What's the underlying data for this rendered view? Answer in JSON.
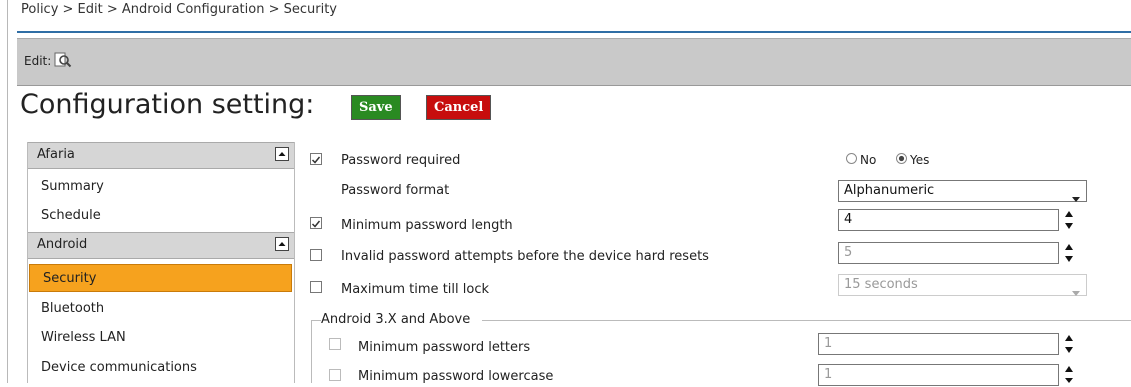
{
  "breadcrumb": "Policy > Edit > Android Configuration > Security",
  "editbar": {
    "label": "Edit:",
    "icon": "search-document-icon"
  },
  "heading": "Configuration setting:",
  "buttons": {
    "save": "Save",
    "cancel": "Cancel"
  },
  "colors": {
    "accent": "#2f6ea5",
    "save": "#2a8a22",
    "cancel": "#c70d0d",
    "active_item": "#f6a21e"
  },
  "sidebar": {
    "sections": [
      {
        "label": "Afaria",
        "items": [
          "Summary",
          "Schedule"
        ]
      },
      {
        "label": "Android",
        "items": [
          "Security",
          "Bluetooth",
          "Wireless LAN",
          "Device communications"
        ]
      }
    ],
    "active": "Security"
  },
  "settings": {
    "password_required": {
      "label": "Password required",
      "checked": true,
      "no": "No",
      "yes": "Yes",
      "selected": "Yes"
    },
    "password_format": {
      "label": "Password format",
      "value": "Alphanumeric"
    },
    "min_length": {
      "label": "Minimum password length",
      "checked": true,
      "value": "4"
    },
    "invalid_attempts": {
      "label": "Invalid password attempts before the device hard resets",
      "checked": false,
      "value": "5"
    },
    "max_lock": {
      "label": "Maximum time till lock",
      "checked": false,
      "value": "15 seconds"
    }
  },
  "android3": {
    "legend": "Android 3.X and Above",
    "min_letters": {
      "label": "Minimum password letters",
      "value": "1"
    },
    "min_lowercase": {
      "label": "Minimum password lowercase",
      "value": "1"
    }
  }
}
